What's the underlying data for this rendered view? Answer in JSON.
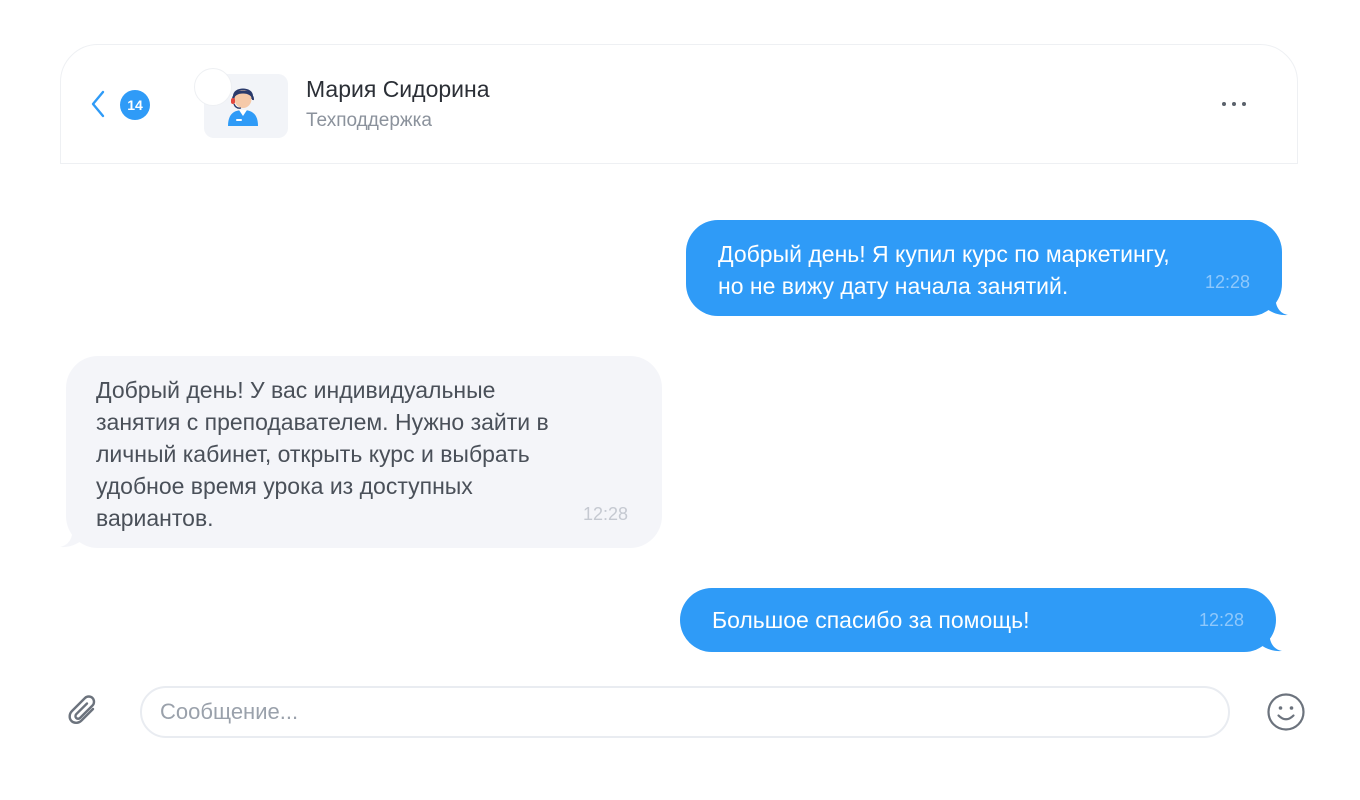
{
  "header": {
    "unread_count": "14",
    "contact_name": "Мария Сидорина",
    "contact_role": "Техподдержка"
  },
  "messages": [
    {
      "direction": "outgoing",
      "lines": [
        "Добрый день! Я купил курс по маркетингу,",
        "но не вижу дату начала занятий."
      ],
      "time": "12:28"
    },
    {
      "direction": "incoming",
      "lines": [
        "Добрый день! У вас индивидуальные",
        "занятия с преподавателем. Нужно зайти в",
        "личный кабинет, открыть курс и выбрать",
        "удобное время урока из доступных",
        "вариантов."
      ],
      "time": "12:28"
    },
    {
      "direction": "outgoing",
      "lines": [
        "Большое спасибо за помощь!"
      ],
      "time": "12:28"
    }
  ],
  "composer": {
    "placeholder": "Сообщение...",
    "value": ""
  },
  "icons": {
    "back": "chevron-left-icon",
    "more": "more-horizontal-icon",
    "attach": "paperclip-icon",
    "emoji": "smiley-icon",
    "avatar": "support-agent-icon"
  },
  "colors": {
    "accent": "#2f9bf7",
    "incoming_bubble": "#f4f5f9",
    "text_primary": "#2b2f36",
    "text_secondary": "#8b929c"
  }
}
